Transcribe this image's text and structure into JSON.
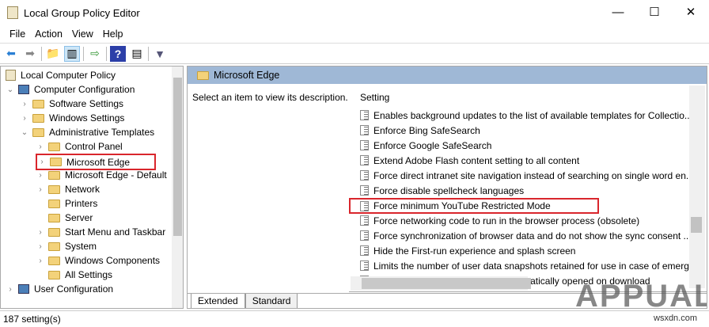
{
  "window": {
    "title": "Local Group Policy Editor",
    "minimize": "—",
    "maximize": "☐",
    "close": "✕"
  },
  "menu": [
    "File",
    "Action",
    "View",
    "Help"
  ],
  "tree": [
    {
      "label": "Local Computer Policy",
      "level": 0,
      "chev": ""
    },
    {
      "label": "Computer Configuration",
      "level": 0,
      "chev": "⌄"
    },
    {
      "label": "Software Settings",
      "level": 1,
      "chev": "›"
    },
    {
      "label": "Windows Settings",
      "level": 1,
      "chev": "›"
    },
    {
      "label": "Administrative Templates",
      "level": 1,
      "chev": "⌄"
    },
    {
      "label": "Control Panel",
      "level": 2,
      "chev": "›"
    },
    {
      "label": "Microsoft Edge",
      "level": 2,
      "chev": "›"
    },
    {
      "label": "Microsoft Edge - Default",
      "level": 2,
      "chev": "›"
    },
    {
      "label": "Network",
      "level": 2,
      "chev": "›"
    },
    {
      "label": "Printers",
      "level": 2,
      "chev": ""
    },
    {
      "label": "Server",
      "level": 2,
      "chev": ""
    },
    {
      "label": "Start Menu and Taskbar",
      "level": 2,
      "chev": "›"
    },
    {
      "label": "System",
      "level": 2,
      "chev": "›"
    },
    {
      "label": "Windows Components",
      "level": 2,
      "chev": "›"
    },
    {
      "label": "All Settings",
      "level": 2,
      "chev": ""
    },
    {
      "label": "User Configuration",
      "level": 0,
      "chev": "›"
    }
  ],
  "panel": {
    "header": "Microsoft Edge",
    "description": "Select an item to view its description.",
    "column": "Setting"
  },
  "settings": [
    "Enables background updates to the list of available templates for Collectio...",
    "Enforce Bing SafeSearch",
    "Enforce Google SafeSearch",
    "Extend Adobe Flash content setting to all content",
    "Force direct intranet site navigation instead of searching on single word en...",
    "Force disable spellcheck languages",
    "Force minimum YouTube Restricted Mode",
    "Force networking code to run in the browser process (obsolete)",
    "Force synchronization of browser data and do not show the sync consent ...",
    "Hide the First-run experience and splash screen",
    "Limits the number of user data snapshots retained for use in case of emerg...",
    "List of file types that should be automatically opened on download"
  ],
  "tabs": [
    "Extended",
    "Standard"
  ],
  "status": "187 setting(s)",
  "watermark": "APPUALS",
  "site": "wsxdn.com",
  "colors": {
    "highlight": "#d9262c",
    "header": "#9fb8d6"
  }
}
